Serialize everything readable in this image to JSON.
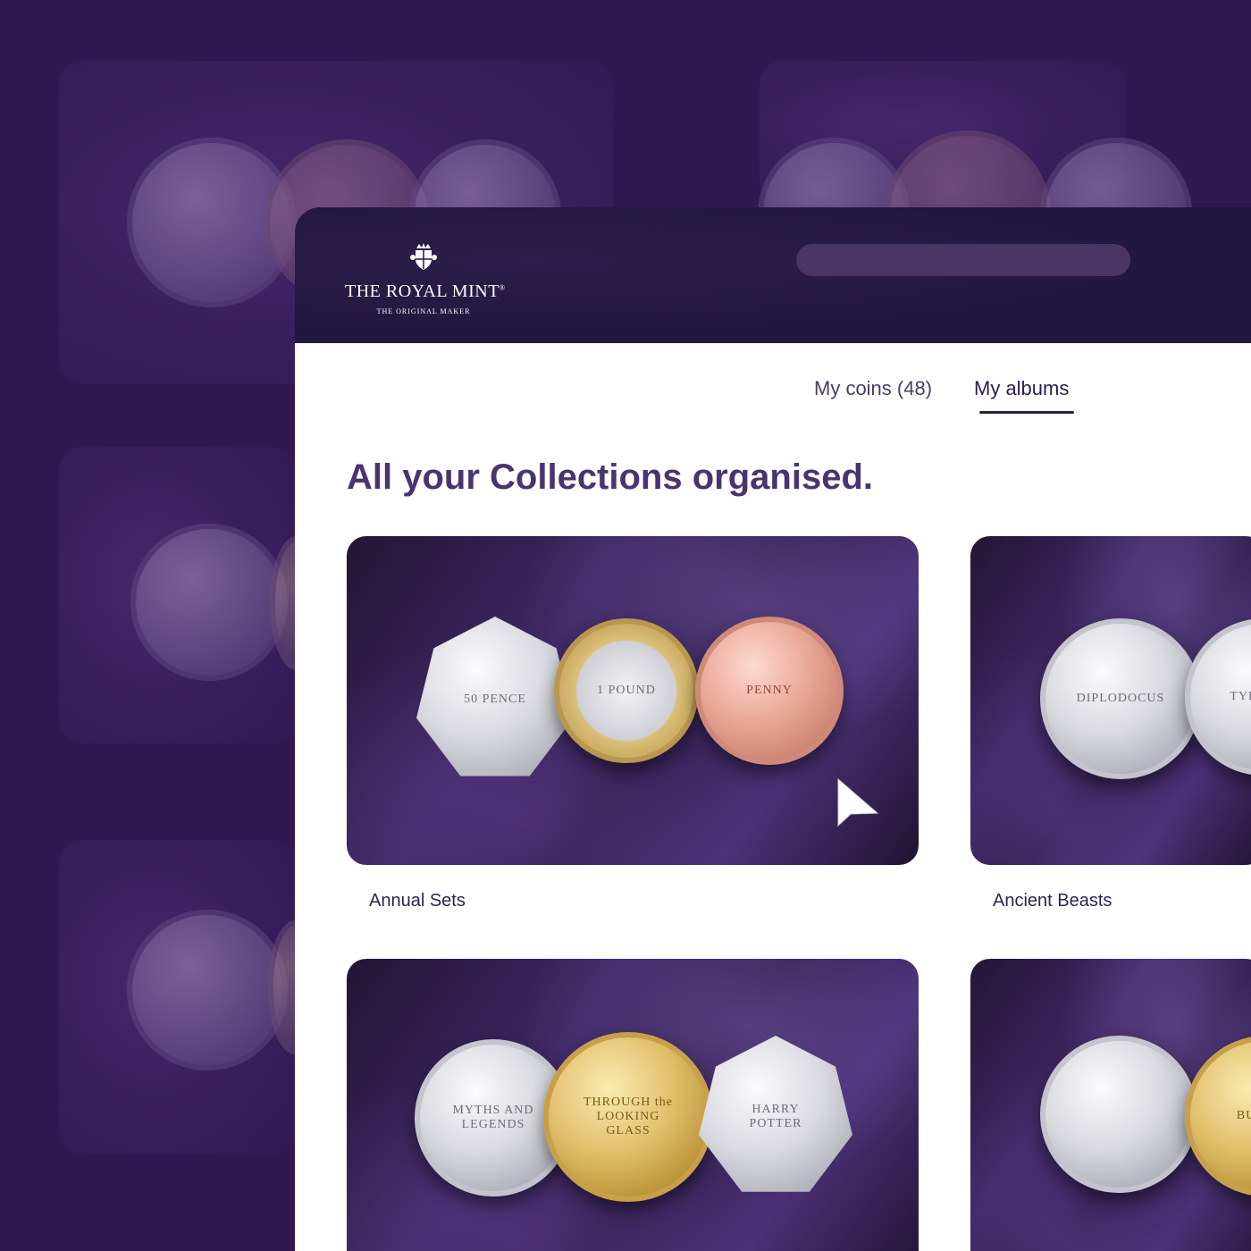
{
  "brand": {
    "name": "THE ROYAL MINT",
    "registered_mark": "®",
    "tagline": "THE ORIGINAL MAKER"
  },
  "colors": {
    "page_background": "#311853",
    "header_background": "#22173f",
    "search_bar": "#4b3565",
    "heading_text": "#4a3470",
    "tab_active_text": "#2a1c4f"
  },
  "tabs": [
    {
      "label": "My coins (48)",
      "active": false
    },
    {
      "label": "My albums",
      "active": true
    }
  ],
  "heading": "All your Collections organised.",
  "albums": [
    {
      "label": "Annual Sets",
      "coins": [
        {
          "metal": "silver",
          "shape": "heptagon",
          "inscription": "50 PENCE"
        },
        {
          "metal": "bimetal",
          "shape": "round",
          "inscription": "1 POUND"
        },
        {
          "metal": "copper",
          "shape": "round",
          "inscription": "PENNY"
        }
      ]
    },
    {
      "label": "Ancient Beasts",
      "coins": [
        {
          "metal": "silver",
          "shape": "round",
          "inscription": "DIPLODOCUS"
        },
        {
          "metal": "silver",
          "shape": "round",
          "inscription": "TYRANNO"
        }
      ]
    },
    {
      "label": "",
      "coins": [
        {
          "metal": "silver",
          "shape": "round",
          "inscription": "MYTHS AND LEGENDS"
        },
        {
          "metal": "gold",
          "shape": "round",
          "inscription": "THROUGH the LOOKING GLASS"
        },
        {
          "metal": "silver",
          "shape": "heptagon",
          "inscription": "HARRY POTTER"
        }
      ]
    },
    {
      "label": "",
      "coins": [
        {
          "metal": "silver",
          "shape": "round",
          "inscription": ""
        },
        {
          "metal": "gold",
          "shape": "round",
          "inscription": "BULL OF"
        }
      ]
    }
  ],
  "icons": [
    "royal-crest-icon",
    "mouse-cursor-icon"
  ]
}
